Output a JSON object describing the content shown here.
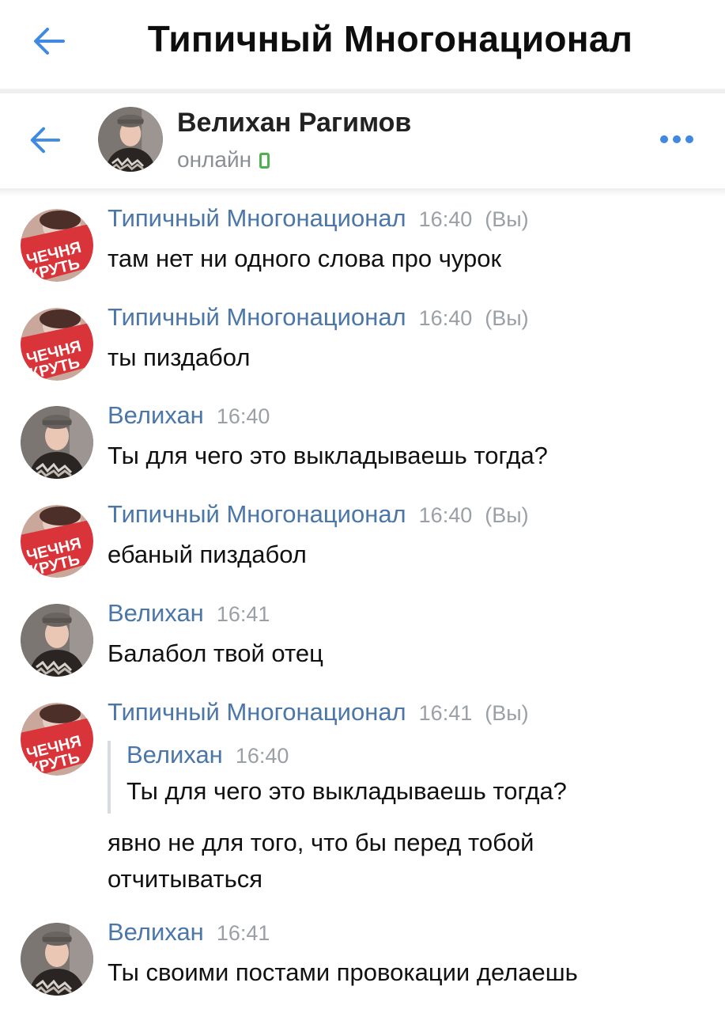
{
  "top_bar": {
    "title": "Типичный Многонационал"
  },
  "chat_header": {
    "name": "Велихан Рагимов",
    "status": "онлайн"
  },
  "messages": [
    {
      "author": "Типичный Многонационал",
      "time": "16:40",
      "you_label": "(Вы)",
      "text": "там нет ни одного слова про чурок",
      "avatar": "group-logo"
    },
    {
      "author": "Типичный Многонационал",
      "time": "16:40",
      "you_label": "(Вы)",
      "text": "ты пиздабол",
      "avatar": "group-logo"
    },
    {
      "author": "Велихан",
      "time": "16:40",
      "text": "Ты для чего это выкладываешь тогда?",
      "avatar": "user-photo"
    },
    {
      "author": "Типичный Многонационал",
      "time": "16:40",
      "you_label": "(Вы)",
      "text": "ебаный пиздабол",
      "avatar": "group-logo"
    },
    {
      "author": "Велихан",
      "time": "16:41",
      "text": "Балабол твой отец",
      "avatar": "user-photo"
    },
    {
      "author": "Типичный Многонационал",
      "time": "16:41",
      "you_label": "(Вы)",
      "quote": {
        "author": "Велихан",
        "time": "16:40",
        "text": "Ты для чего это выкладываешь тогда?"
      },
      "text_line1": "явно не для того, что бы перед тобой",
      "text_line2": "отчитываться",
      "avatar": "group-logo"
    },
    {
      "author": "Велихан",
      "time": "16:41",
      "text": "Ты своими постами провокации делаешь",
      "avatar": "user-photo"
    }
  ],
  "avatar_logo_text": {
    "line1": "ЧЕЧНЯ",
    "line2": "КРУТЬ"
  },
  "colors": {
    "link_blue": "#4a76a8",
    "online_green": "#4bb34b",
    "accent_icon": "#3f8ae0",
    "logo_red": "#d9343a"
  }
}
